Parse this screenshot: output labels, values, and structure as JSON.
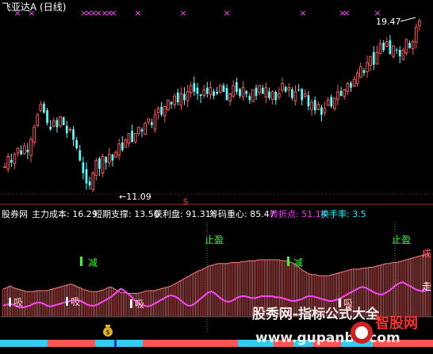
{
  "header": {
    "title": "飞亚达A (日线)"
  },
  "price_labels": {
    "high": "19.47",
    "low": "11.09"
  },
  "indicator_bar": {
    "name": "股券网",
    "items": [
      {
        "label": "主力成本:",
        "value": "16.29",
        "color": "#ffffff"
      },
      {
        "label": "短期支撑:",
        "value": "13.50",
        "color": "#ffffff"
      },
      {
        "label": "获利盘:",
        "value": "91.31",
        "color": "#ffffff"
      },
      {
        "label": "筹码重心:",
        "value": "85.47",
        "color": "#ffffff"
      },
      {
        "label": "转折点:",
        "value": "51.14",
        "color": "#ff33ff"
      },
      {
        "label": "换手率:",
        "value": "3.5",
        "color": "#00ffff"
      }
    ]
  },
  "signals": {
    "reduce_1": "减",
    "reduce_2": "减",
    "take_profit_1": "止盈",
    "take_profit_2": "止盈",
    "absorb_1": "吸",
    "absorb_2": "吸",
    "absorb_3": "吸",
    "absorb_4": "吸",
    "cheng": "成",
    "zou": "走"
  },
  "watermark": {
    "line1": "股秀网-指标公式大全",
    "line2": "www.gupanbu.com",
    "logo_text": "智股网"
  },
  "colors": {
    "up": "#ff5050",
    "down": "#54ffff",
    "hist": "#ff6060",
    "magenta": "#ff44ff",
    "green_signal": "#30ff30",
    "grid": "#993333"
  },
  "chart_data": [
    {
      "type": "candlestick",
      "title": "飞亚达A (日线)",
      "xlabel": "",
      "ylabel": "",
      "ylim": [
        10.5,
        20.0
      ],
      "annotations": [
        {
          "text": "19.47",
          "value": 19.47
        },
        {
          "text": "11.09",
          "value": 11.09
        }
      ],
      "close": [
        12.3,
        12.8,
        12.5,
        12.9,
        13.2,
        12.9,
        13.3,
        13.0,
        13.6,
        14.2,
        14.8,
        15.3,
        14.9,
        14.4,
        14.1,
        14.5,
        14.2,
        14.7,
        14.3,
        13.9,
        14.1,
        13.6,
        13.2,
        12.6,
        12.0,
        11.5,
        11.4,
        12.0,
        12.6,
        12.2,
        12.8,
        12.5,
        12.9,
        12.6,
        13.0,
        13.4,
        13.1,
        13.6,
        13.9,
        13.5,
        13.9,
        14.2,
        14.0,
        14.4,
        14.6,
        14.3,
        14.8,
        15.1,
        14.8,
        15.2,
        15.5,
        15.3,
        15.7,
        15.4,
        15.8,
        15.5,
        15.9,
        16.2,
        15.9,
        15.8,
        15.7,
        16.0,
        15.8,
        16.1,
        15.7,
        15.8,
        16.2,
        15.9,
        15.5,
        15.8,
        16.2,
        15.9,
        15.7,
        16.1,
        15.8,
        15.5,
        16.0,
        15.7,
        16.2,
        15.8,
        16.1,
        15.6,
        15.9,
        15.5,
        15.8,
        16.3,
        15.9,
        16.1,
        15.6,
        15.9,
        16.0,
        15.5,
        15.8,
        15.2,
        15.4,
        15.0,
        15.3,
        14.8,
        15.1,
        15.5,
        15.2,
        15.6,
        15.9,
        15.7,
        16.0,
        16.3,
        16.1,
        16.5,
        16.8,
        17.1,
        16.8,
        17.3,
        17.6,
        17.2,
        17.8,
        18.2,
        17.9,
        18.3,
        17.7,
        18.1,
        17.9,
        17.6,
        17.9,
        18.4,
        18.0,
        18.3,
        19.0,
        19.3
      ]
    },
    {
      "type": "area",
      "title": "",
      "series_name": "",
      "ylim": [
        0,
        100
      ],
      "values": [
        30,
        31,
        33,
        31,
        30,
        29,
        28,
        27,
        27,
        27,
        28,
        28,
        28,
        28,
        29,
        30,
        31,
        32,
        33,
        34,
        35,
        34,
        32,
        31,
        29,
        28,
        27,
        27,
        27,
        28,
        29,
        31,
        32,
        30,
        28,
        26,
        26,
        25,
        25,
        25,
        25,
        26,
        27,
        28,
        28,
        28,
        29,
        30,
        31,
        32,
        33,
        35,
        37,
        39,
        41,
        43,
        45,
        47,
        49,
        50,
        52,
        54,
        55,
        56,
        57,
        57,
        57,
        57,
        58,
        58,
        58,
        59,
        59,
        60,
        60,
        60,
        61,
        61,
        61,
        61,
        61,
        61,
        61,
        60,
        60,
        59,
        58,
        56,
        53,
        50,
        48,
        46,
        45,
        45,
        44,
        44,
        44,
        44,
        45,
        46,
        47,
        48,
        49,
        50,
        51,
        51,
        51,
        52,
        52,
        53,
        53,
        54,
        55,
        56,
        57,
        57,
        58,
        58,
        59,
        60,
        61,
        62,
        63,
        64,
        65,
        66,
        67,
        68
      ],
      "line_values": [
        12,
        13,
        14,
        13,
        11,
        10,
        10,
        11,
        12,
        14,
        15,
        15,
        14,
        12,
        11,
        12,
        13,
        14,
        15,
        16,
        17,
        18,
        18,
        17,
        15,
        13,
        12,
        12,
        13,
        15,
        17,
        19,
        21,
        24,
        27,
        30,
        28,
        25,
        22,
        18,
        15,
        13,
        12,
        11,
        12,
        14,
        16,
        18,
        20,
        22,
        23,
        22,
        20,
        17,
        14,
        12,
        12,
        14,
        17,
        20,
        23,
        26,
        27,
        25,
        22,
        19,
        17,
        16,
        17,
        19,
        21,
        22,
        22,
        21,
        20,
        20,
        21,
        22,
        22,
        22,
        22,
        21,
        21,
        20,
        19,
        18,
        17,
        17,
        18,
        19,
        21,
        22,
        22,
        21,
        20,
        19,
        18,
        17,
        17,
        18,
        19,
        21,
        23,
        25,
        27,
        29,
        31,
        32,
        31,
        29,
        27,
        25,
        24,
        24,
        26,
        28,
        31,
        34,
        36,
        37,
        35,
        33,
        31,
        29,
        28,
        27,
        28,
        29
      ]
    }
  ]
}
